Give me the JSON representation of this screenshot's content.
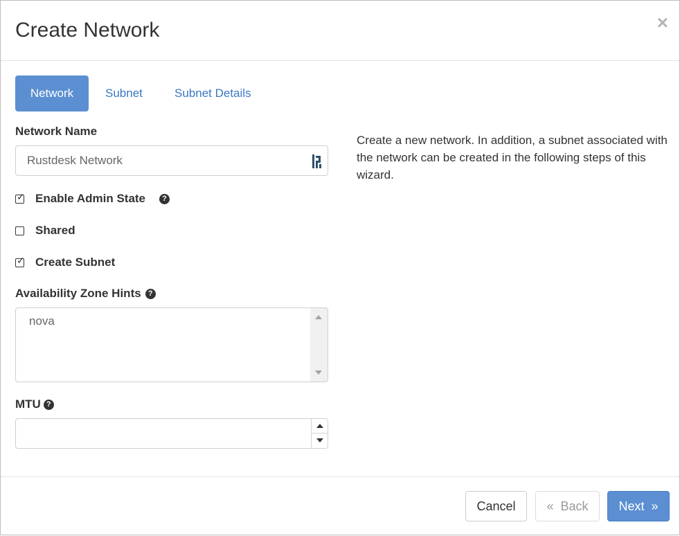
{
  "dialog": {
    "title": "Create Network",
    "close_symbol": "×"
  },
  "tabs": [
    {
      "label": "Network",
      "active": true
    },
    {
      "label": "Subnet",
      "active": false
    },
    {
      "label": "Subnet Details",
      "active": false
    }
  ],
  "form": {
    "network_name": {
      "label": "Network Name",
      "value": "Rustdesk Network",
      "addon_icon": "password-manager-icon"
    },
    "enable_admin_state": {
      "label": "Enable Admin State",
      "checked": true,
      "help_icon": "question-circle-icon"
    },
    "shared": {
      "label": "Shared",
      "checked": false
    },
    "create_subnet": {
      "label": "Create Subnet",
      "checked": true
    },
    "availability_zone_hints": {
      "label": "Availability Zone Hints",
      "help_icon": "question-circle-icon",
      "options": [
        "nova"
      ]
    },
    "mtu": {
      "label": "MTU",
      "help_icon": "question-circle-icon",
      "value": ""
    }
  },
  "help_text": "Create a new network. In addition, a subnet associated with the network can be created in the following steps of this wizard.",
  "footer": {
    "cancel_label": "Cancel",
    "back_label": "«  Back",
    "next_label": "Next  »"
  },
  "colors": {
    "primary": "#5b8fd1",
    "link": "#3a77c4",
    "text": "#333333",
    "muted": "#999999"
  }
}
